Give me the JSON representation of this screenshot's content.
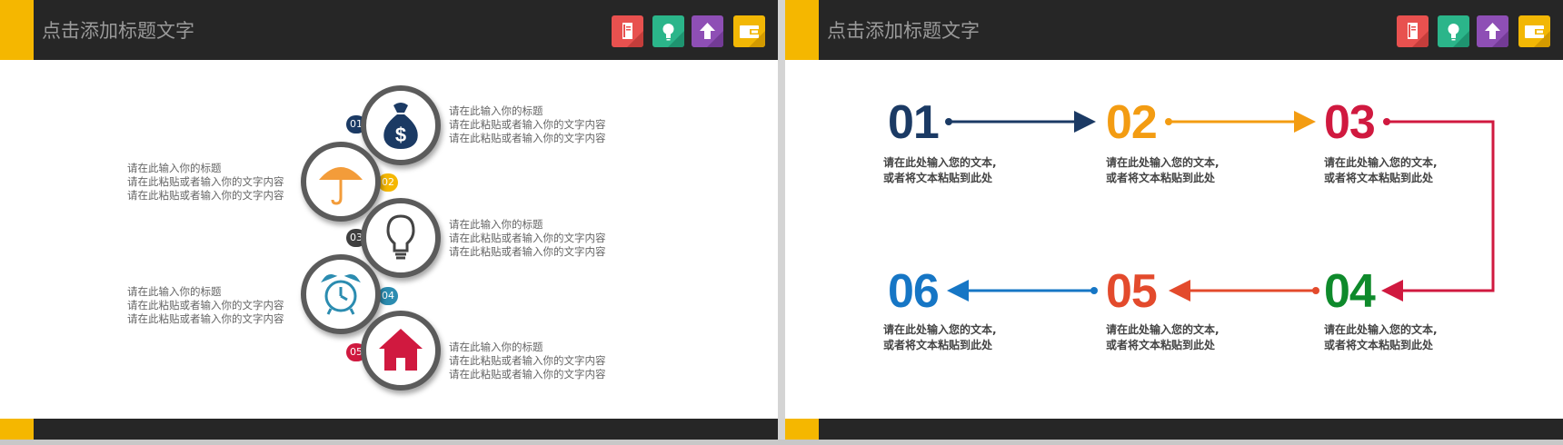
{
  "slide_left": {
    "header_title": "点击添加标题文字",
    "items": [
      {
        "badge": "01",
        "title": "请在此输入你的标题",
        "line1": "请在此粘贴或者输入你的文字内容",
        "line2": "请在此粘贴或者输入你的文字内容",
        "icon": "money-bag-icon"
      },
      {
        "badge": "02",
        "title": "请在此输入你的标题",
        "line1": "请在此粘贴或者输入你的文字内容",
        "line2": "请在此粘贴或者输入你的文字内容",
        "icon": "umbrella-icon"
      },
      {
        "badge": "03",
        "title": "请在此输入你的标题",
        "line1": "请在此粘贴或者输入你的文字内容",
        "line2": "请在此粘贴或者输入你的文字内容",
        "icon": "lightbulb-icon"
      },
      {
        "badge": "04",
        "title": "请在此输入你的标题",
        "line1": "请在此粘贴或者输入你的文字内容",
        "line2": "请在此粘贴或者输入你的文字内容",
        "icon": "alarm-clock-icon"
      },
      {
        "badge": "05",
        "title": "请在此输入你的标题",
        "line1": "请在此粘贴或者输入你的文字内容",
        "line2": "请在此粘贴或者输入你的文字内容",
        "icon": "house-icon"
      }
    ]
  },
  "slide_right": {
    "header_title": "点击添加标题文字",
    "steps": [
      {
        "num": "01",
        "line1": "请在此处输入您的文本,",
        "line2": "或者将文本粘贴到此处"
      },
      {
        "num": "02",
        "line1": "请在此处输入您的文本,",
        "line2": "或者将文本粘贴到此处"
      },
      {
        "num": "03",
        "line1": "请在此处输入您的文本,",
        "line2": "或者将文本粘贴到此处"
      },
      {
        "num": "04",
        "line1": "请在此处输入您的文本,",
        "line2": "或者将文本粘贴到此处"
      },
      {
        "num": "05",
        "line1": "请在此处输入您的文本,",
        "line2": "或者将文本粘贴到此处"
      },
      {
        "num": "06",
        "line1": "请在此处输入您的文本,",
        "line2": "或者将文本粘贴到此处"
      }
    ]
  },
  "header_icons": [
    "notebook-icon",
    "lightbulb-icon",
    "upload-arrow-icon",
    "wallet-icon"
  ],
  "colors": {
    "header_bg": "#262626",
    "accent": "#f5b700",
    "icon_red": "#e8514f",
    "icon_green": "#2bb58a",
    "icon_purple": "#8e4fb5",
    "icon_yellow": "#f2b705",
    "step01": "#1b3a64",
    "step02": "#f39c12",
    "step03": "#d0193f",
    "step04": "#0e8a2b",
    "step05": "#e34a2c",
    "step06": "#1676c5",
    "badge01": "#1b3a64",
    "badge02": "#f5b700",
    "badge03": "#3f3f3f",
    "badge04": "#2b8cb0",
    "badge05": "#d0193f"
  }
}
